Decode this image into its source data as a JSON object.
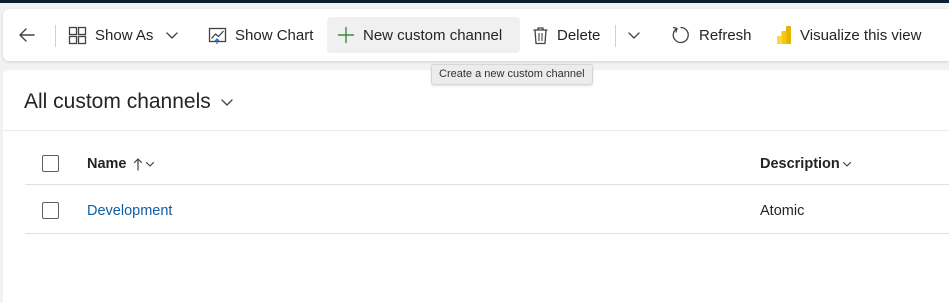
{
  "toolbar": {
    "show_as_label": "Show As",
    "show_chart_label": "Show Chart",
    "new_label": "New custom channel",
    "delete_label": "Delete",
    "refresh_label": "Refresh",
    "visualize_label": "Visualize this view"
  },
  "tooltip": {
    "text": "Create a new custom channel"
  },
  "view": {
    "title": "All custom channels"
  },
  "grid": {
    "columns": {
      "name": "Name",
      "description": "Description"
    },
    "rows": [
      {
        "name": "Development",
        "description": "Atomic"
      }
    ]
  },
  "colors": {
    "link": "#115ea3",
    "new_icon": "#3a8a3a",
    "powerbi_icon": "#f2c811",
    "topbar": "#0b1f33"
  }
}
